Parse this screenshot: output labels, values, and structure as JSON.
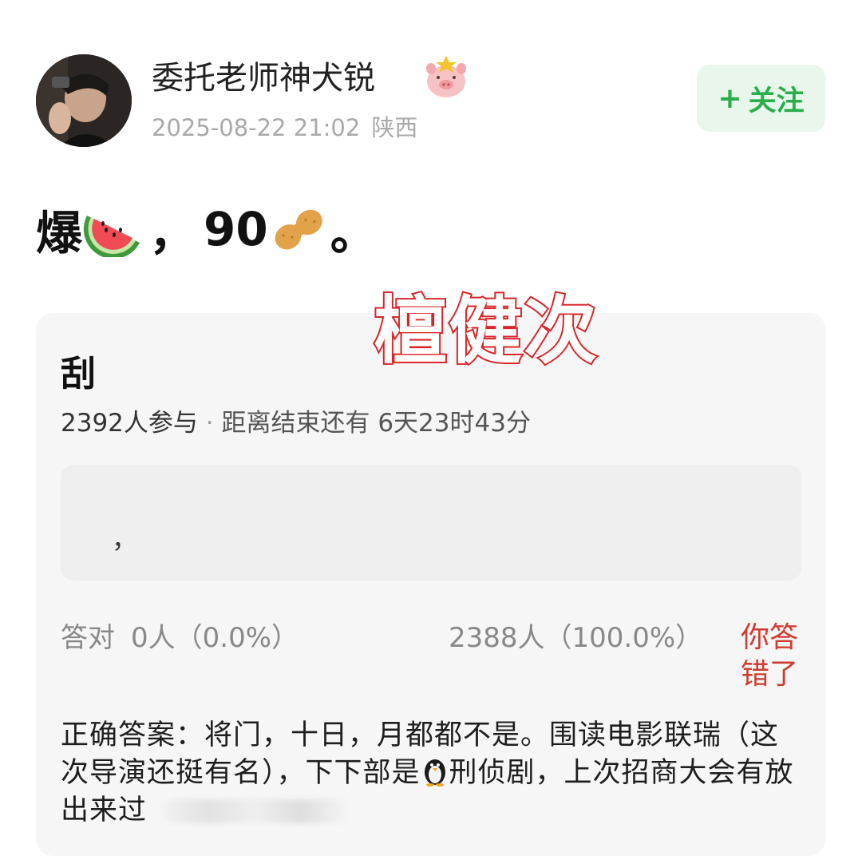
{
  "author": {
    "name": "委托老师神犬锐",
    "timestamp": "2025-08-22 21:02",
    "location": "陕西",
    "avatar_icon": "avatar-photo",
    "badge_icon": "pig-crown-icon"
  },
  "follow_button": {
    "plus": "+",
    "label": "关注",
    "accent": "#2aae4b"
  },
  "post": {
    "prefix": "爆",
    "emoji_1": "watermelon-icon",
    "separator": "，",
    "number": "90",
    "emoji_2": "peanut-icon",
    "suffix": "。"
  },
  "watermark": "檀健次",
  "poll": {
    "title": "刮",
    "participants": "2392人参与",
    "dot": " · ",
    "remaining": "距离结束还有 6天23时43分",
    "answer_value": "，",
    "correct_label": "答对",
    "correct_count": "0人（0.0%）",
    "wrong_count": "2388人（100.0%）",
    "result": "你答错了",
    "result_color": "#cf3b33",
    "explanation_part1": "正确答案：将门，十日，月都都不是。围读电影联瑞（这次导演还挺有名），下下部是",
    "explanation_emoji": "penguin-icon",
    "explanation_part2": "刑侦剧，上次招商大会有放出来过"
  }
}
